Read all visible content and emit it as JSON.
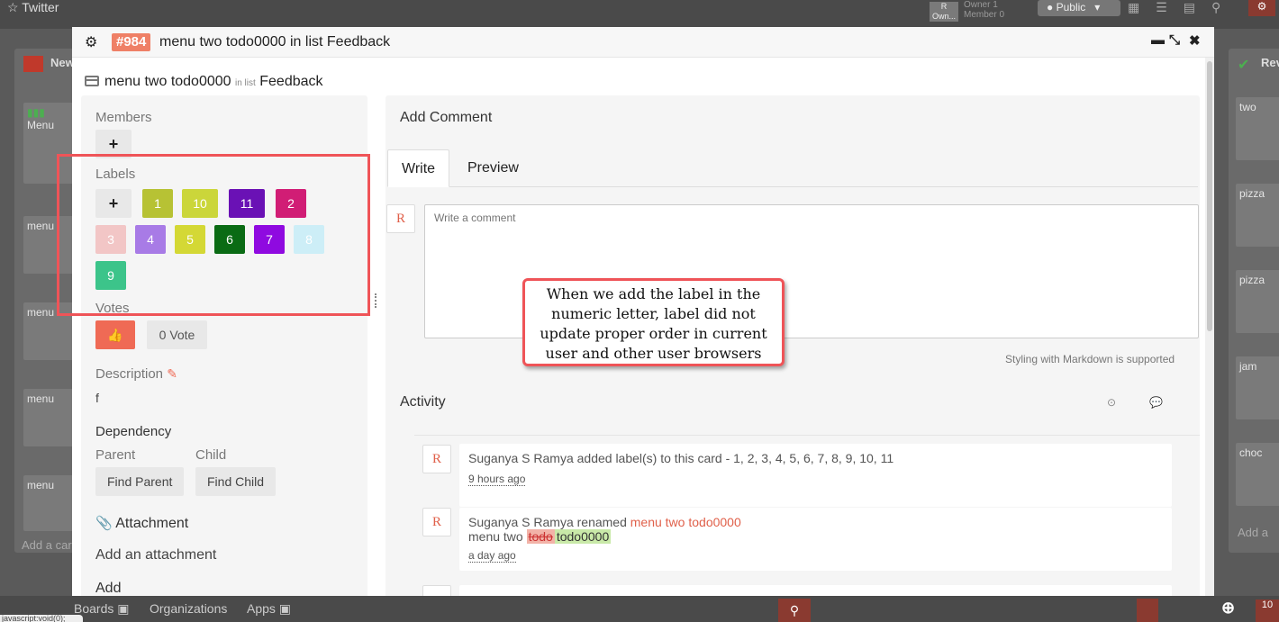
{
  "background": {
    "board_title": "Twitter",
    "owner_avatar": "R",
    "owner_avatar_sub": "Own...",
    "owner_label": "Owner 1",
    "member_label": "Member 0",
    "visibility": "Public",
    "left_list_title": "New",
    "left_cards": [
      "Menu",
      "menu",
      "menu",
      "menu",
      "menu"
    ],
    "right_list_title": "Rev",
    "right_cards": [
      "two",
      "pizza",
      "pizza",
      "jam",
      "choc"
    ],
    "add_card": "Add a card",
    "add_card_right": "Add a",
    "nav": {
      "boards": "Boards",
      "organizations": "Organizations",
      "apps": "Apps"
    },
    "status_bar": "javascript:void(0);",
    "notification_count": "10"
  },
  "modal": {
    "card_number": "#984",
    "title": "menu two todo0000 in list Feedback",
    "card_name": "menu two todo0000",
    "in_list": "in list",
    "list_name": "Feedback",
    "members_label": "Members",
    "labels_label": "Labels",
    "labels": [
      {
        "text": "1",
        "color": "#b7c234",
        "text_color": "#ffffff"
      },
      {
        "text": "10",
        "color": "#cbd63a",
        "text_color": "#ffffff"
      },
      {
        "text": "11",
        "color": "#6a11b5",
        "text_color": "#ffffff"
      },
      {
        "text": "2",
        "color": "#d11d75",
        "text_color": "#ffffff"
      },
      {
        "text": "3",
        "color": "#f2c6c6",
        "text_color": "#ffffff"
      },
      {
        "text": "4",
        "color": "#a87be6",
        "text_color": "#ffffff"
      },
      {
        "text": "5",
        "color": "#d4d835",
        "text_color": "#ffffff"
      },
      {
        "text": "6",
        "color": "#0a6b14",
        "text_color": "#ffffff"
      },
      {
        "text": "7",
        "color": "#8f0ae0",
        "text_color": "#ffffff"
      },
      {
        "text": "8",
        "color": "#cdeef7",
        "text_color": "#ffffff"
      },
      {
        "text": "9",
        "color": "#3cc48a",
        "text_color": "#ffffff"
      }
    ],
    "votes_label": "Votes",
    "vote_count": "0 Vote",
    "description_label": "Description",
    "description_text": "f",
    "dependency_label": "Dependency",
    "parent_label": "Parent",
    "child_label": "Child",
    "find_parent": "Find Parent",
    "find_child": "Find Child",
    "attachment_label": "Attachment",
    "add_attachment": "Add an attachment",
    "add_more": "Add",
    "add_comment_title": "Add Comment",
    "tabs": [
      "Write",
      "Preview"
    ],
    "user_avatar": "R",
    "comment_placeholder": "Write a comment",
    "markdown_note": "Styling with Markdown is supported",
    "activity_label": "Activity",
    "activities": [
      {
        "text": "Suganya S Ramya added label(s) to this card - 1, 2, 3, 4, 5, 6, 7, 8, 9, 10, 11",
        "time": "9 hours ago"
      },
      {
        "prefix": "Suganya S Ramya renamed ",
        "link": "menu two todo0000",
        "line2_prefix": "menu two ",
        "deleted": "todo",
        "inserted": "todo0000",
        "time": "a day ago"
      }
    ]
  },
  "annotation": {
    "callout_text": "When we add the label in the numeric letter, label did not update proper order in current user and other user browsers",
    "color": "#ef5458"
  }
}
